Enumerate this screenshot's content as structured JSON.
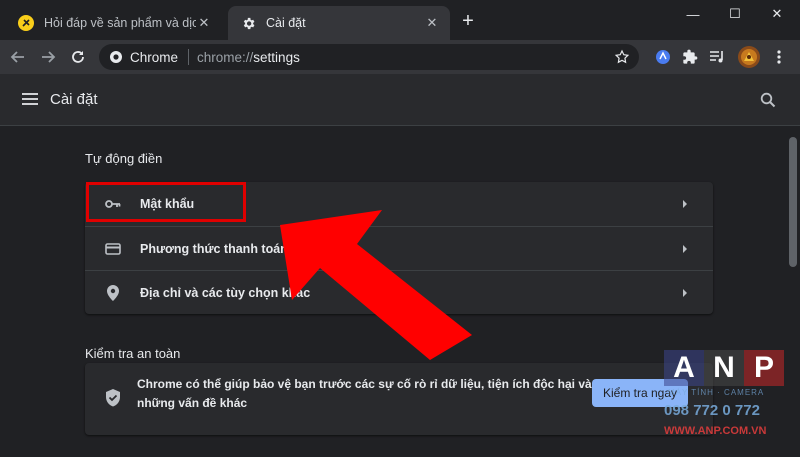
{
  "tabs": [
    {
      "label": "Hỏi đáp về sản phẩm và dịch vụ t",
      "close": "✕"
    },
    {
      "label": "Cài đặt",
      "close": "✕"
    }
  ],
  "new_tab": "+",
  "window_controls": {
    "minimize": "—",
    "maximize": "☐",
    "close": "✕"
  },
  "omnibox": {
    "chip": "Chrome",
    "url_scheme": "chrome://",
    "url_path": "settings"
  },
  "settings": {
    "title": "Cài đặt"
  },
  "autofill": {
    "title": "Tự động điền",
    "items": [
      {
        "label": "Mật khẩu",
        "icon": "key-icon"
      },
      {
        "label": "Phương thức thanh toán",
        "icon": "credit-card-icon"
      },
      {
        "label": "Địa chỉ và các tùy chọn khác",
        "icon": "location-pin-icon"
      }
    ]
  },
  "safety": {
    "title": "Kiểm tra an toàn",
    "text": "Chrome có thể giúp bảo vệ bạn trước các sự cố rò rỉ dữ liệu, tiện ích độc hại và những vấn đề khác",
    "button": "Kiểm tra ngay"
  },
  "watermark": {
    "letters": [
      "A",
      "N",
      "P"
    ],
    "subtitle": "MÁY TÍNH · CAMERA",
    "phone": "098 772 0 772",
    "website": "WWW.ANP.COM.VN"
  },
  "colors": {
    "highlight": "#e00000",
    "accent": "#8ab4f8",
    "background": "#202124"
  }
}
